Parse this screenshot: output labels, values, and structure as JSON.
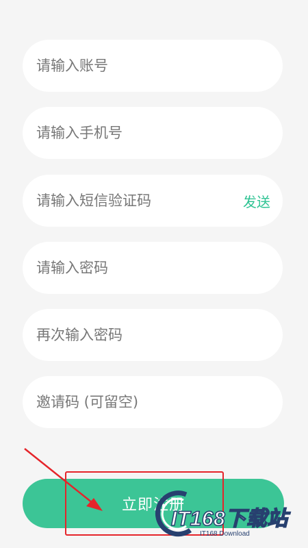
{
  "form": {
    "account_placeholder": "请输入账号",
    "phone_placeholder": "请输入手机号",
    "sms_code_placeholder": "请输入短信验证码",
    "send_label": "发送",
    "password_placeholder": "请输入密码",
    "confirm_password_placeholder": "再次输入密码",
    "invite_code_placeholder": "邀请码 (可留空)",
    "submit_label": "立即注册"
  },
  "watermark": {
    "brand": "IT168下载站",
    "subtitle": "IT168 Download"
  },
  "colors": {
    "accent": "#3cc596",
    "send_link": "#2ec393",
    "annotation_red": "#e5242a",
    "background": "#f5f5f5"
  }
}
